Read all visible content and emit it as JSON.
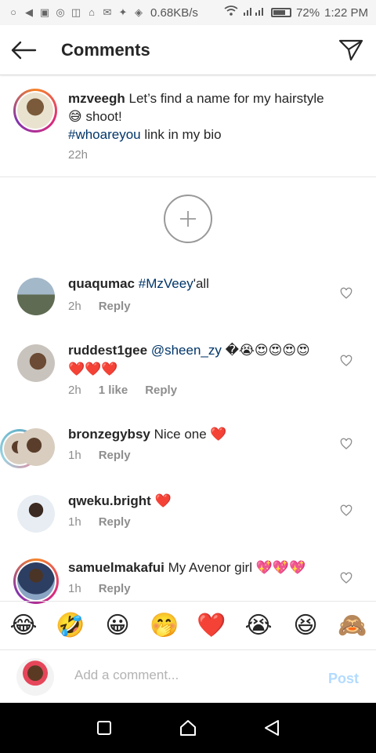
{
  "status_bar": {
    "net_speed": "0.68KB/s",
    "battery": "72%",
    "time": "1:22 PM"
  },
  "header": {
    "title": "Comments"
  },
  "caption": {
    "username": "mzveegh",
    "text": "Let’s find a name for my hairstyle 😅 shoot!",
    "hashtag": "#whoareyou",
    "text_after": "link in my bio",
    "time": "22h"
  },
  "comments": [
    {
      "username": "quaqumac",
      "mention": "#MzVeey",
      "text": "'all",
      "time": "2h",
      "likes": "",
      "reply": "Reply"
    },
    {
      "username": "ruddest1gee",
      "mention": "@sheen_zy",
      "text": "�😭😍😍😍😍❤️❤️❤️",
      "time": "2h",
      "likes": "1 like",
      "reply": "Reply"
    },
    {
      "username": "bronzegybsy",
      "mention": "",
      "text": "Nice one ❤️",
      "time": "1h",
      "likes": "",
      "reply": "Reply"
    },
    {
      "username": "qweku.bright",
      "mention": "",
      "text": "❤️",
      "time": "1h",
      "likes": "",
      "reply": "Reply"
    },
    {
      "username": "samuelmakafui",
      "mention": "",
      "text": "My Avenor girl 💖💖💖",
      "time": "1h",
      "likes": "",
      "reply": "Reply"
    }
  ],
  "emoji_bar": [
    "😂",
    "🤣",
    "😀",
    "🤭",
    "❤️",
    "😭",
    "😆",
    "🙈"
  ],
  "composer": {
    "placeholder": "Add a comment...",
    "post_label": "Post"
  },
  "colors": {
    "link": "#003569",
    "post_disabled": "#b3dbff",
    "meta": "#8e8e8e"
  }
}
